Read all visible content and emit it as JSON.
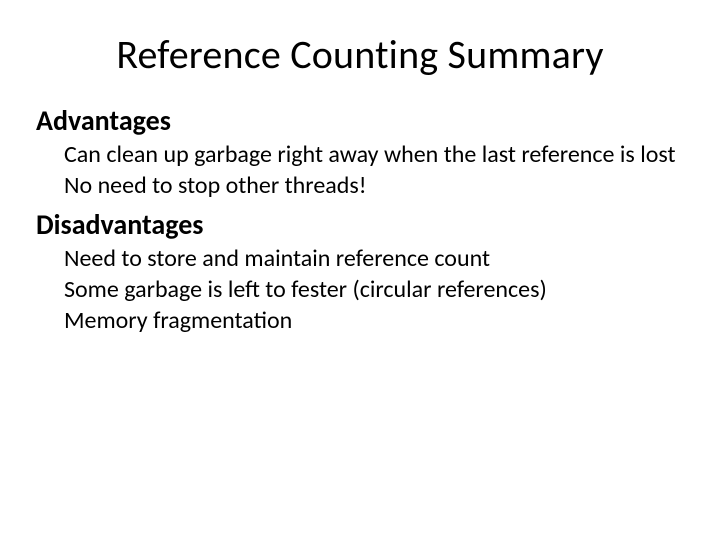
{
  "title": "Reference Counting Summary",
  "sections": [
    {
      "heading": "Advantages",
      "items": [
        "Can clean up garbage right away when the last reference is lost",
        "No need to stop other threads!"
      ]
    },
    {
      "heading": "Disadvantages",
      "items": [
        "Need to store and maintain reference count",
        "Some garbage is left to fester (circular references)",
        "Memory fragmentation"
      ]
    }
  ]
}
